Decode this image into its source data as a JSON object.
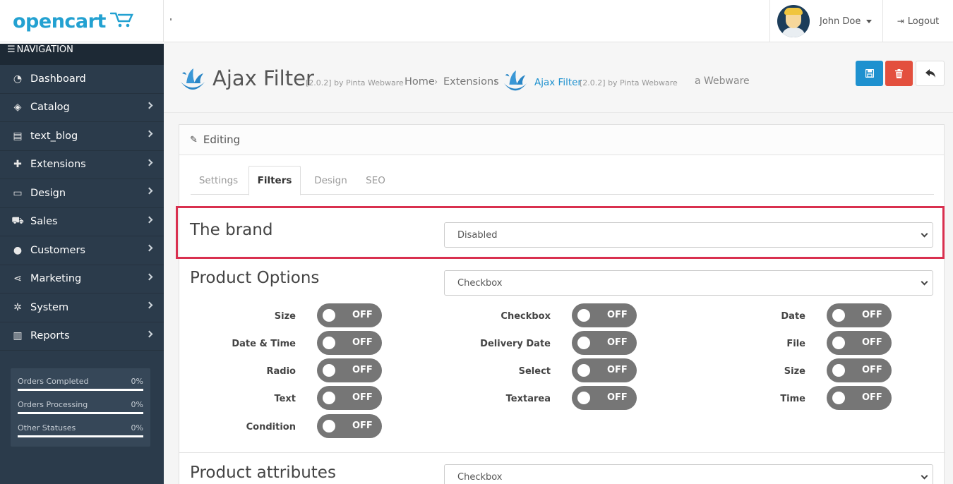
{
  "header": {
    "logo_text": "opencart",
    "user_name": "John Doe",
    "logout_label": "Logout"
  },
  "sidebar": {
    "nav_title": "NAVIGATION",
    "items": [
      {
        "label": "Dashboard",
        "icon": "dashboard-icon"
      },
      {
        "label": "Catalog",
        "icon": "tags-icon"
      },
      {
        "label": "text_blog",
        "icon": "book-icon"
      },
      {
        "label": "Extensions",
        "icon": "puzzle-icon"
      },
      {
        "label": "Design",
        "icon": "monitor-icon"
      },
      {
        "label": "Sales",
        "icon": "cart-icon"
      },
      {
        "label": "Customers",
        "icon": "user-icon"
      },
      {
        "label": "Marketing",
        "icon": "share-icon"
      },
      {
        "label": "System",
        "icon": "gear-icon"
      },
      {
        "label": "Reports",
        "icon": "bar-chart-icon"
      }
    ],
    "stats": [
      {
        "label": "Orders Completed",
        "pct": "0%"
      },
      {
        "label": "Orders Processing",
        "pct": "0%"
      },
      {
        "label": "Other Statuses",
        "pct": "0%"
      }
    ]
  },
  "page": {
    "title": "Ajax Filter",
    "version": "[2.0.2] by Pinta Webware",
    "breadcrumb": {
      "home": "Home",
      "extensions": "Extensions",
      "current": "Ajax Filter",
      "current_version": "[2.0.2] by Pinta Webware",
      "tail": "a Webware"
    }
  },
  "panel": {
    "heading": "Editing",
    "tabs": [
      "Settings",
      "Filters",
      "Design",
      "SEO"
    ],
    "brand": {
      "label": "The brand",
      "value": "Disabled"
    },
    "product_options": {
      "label": "Product Options",
      "value": "Checkbox"
    },
    "product_attributes": {
      "label": "Product attributes",
      "value": "Checkbox"
    },
    "toggle_off": "OFF",
    "options": [
      [
        "Size",
        "Checkbox",
        "Date"
      ],
      [
        "Date & Time",
        "Delivery Date",
        "File"
      ],
      [
        "Radio",
        "Select",
        "Size"
      ],
      [
        "Text",
        "Textarea",
        "Time"
      ],
      [
        "Condition"
      ]
    ]
  },
  "colors": {
    "sidebar_bg": "#2b3b4b",
    "primary": "#1e91cf",
    "danger": "#e3503e",
    "highlight": "#d9304f",
    "toggle_off": "#767676"
  }
}
